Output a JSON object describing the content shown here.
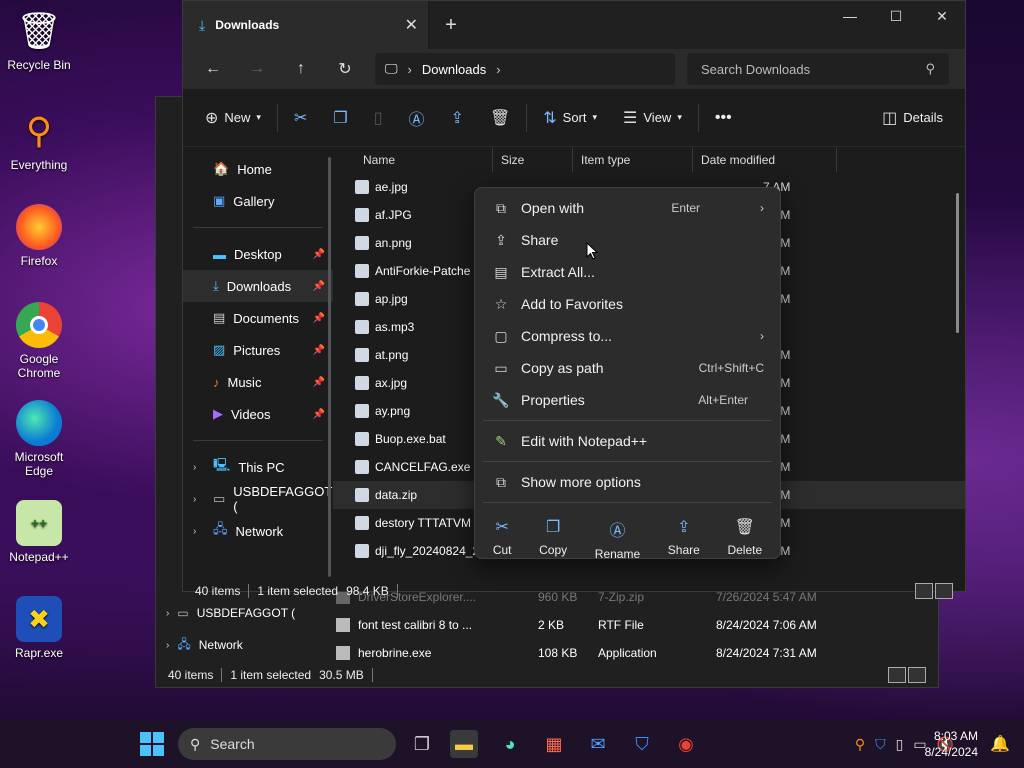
{
  "desktop": [
    {
      "label": "Recycle Bin",
      "icon": "recycle-bin-icon"
    },
    {
      "label": "Everything",
      "icon": "everything-icon"
    },
    {
      "label": "Firefox",
      "icon": "firefox-icon"
    },
    {
      "label": "Google Chrome",
      "icon": "chrome-icon"
    },
    {
      "label": "Microsoft Edge",
      "icon": "edge-icon"
    },
    {
      "label": "Notepad++",
      "icon": "notepad-plus-plus-icon"
    },
    {
      "label": "Rapr.exe",
      "icon": "rapr-icon"
    }
  ],
  "window": {
    "tab_title": "Downloads",
    "address": {
      "segment": "Downloads"
    },
    "search_placeholder": "Search Downloads",
    "toolbar": {
      "new": "New",
      "sort": "Sort",
      "view": "View",
      "details": "Details"
    }
  },
  "sidebar": {
    "home": "Home",
    "gallery": "Gallery",
    "desktop": "Desktop",
    "downloads": "Downloads",
    "documents": "Documents",
    "pictures": "Pictures",
    "music": "Music",
    "videos": "Videos",
    "this_pc": "This PC",
    "usb": "USBDEFAGGOT (",
    "network": "Network"
  },
  "columns": {
    "name": "Name",
    "size": "Size",
    "type": "Item type",
    "date": "Date modified"
  },
  "files": [
    {
      "name": "ae.jpg",
      "time": "7 AM"
    },
    {
      "name": "af.JPG",
      "time": "8 AM"
    },
    {
      "name": "an.png",
      "time": "0 AM"
    },
    {
      "name": "AntiForkie-Patche",
      "time": "8 AM"
    },
    {
      "name": "ap.jpg",
      "time": "0 AM"
    },
    {
      "name": "as.mp3",
      "time": "AM"
    },
    {
      "name": "at.png",
      "time": "8 AM"
    },
    {
      "name": "ax.jpg",
      "time": "8 AM"
    },
    {
      "name": "ay.png",
      "time": "8 AM"
    },
    {
      "name": "Buop.exe.bat",
      "time": "8 AM"
    },
    {
      "name": "CANCELFAG.exe",
      "time": "8 AM"
    },
    {
      "name": "data.zip",
      "time": "6 AM"
    },
    {
      "name": "destory TTTATVM",
      "time": "8 AM"
    },
    {
      "name": "dji_fly_20240824_2",
      "time": "0 AM"
    }
  ],
  "status": {
    "count": "40 items",
    "selected": "1 item selected",
    "size": "98.4 KB"
  },
  "context_menu": {
    "open_with": "Open with",
    "open_with_sc": "Enter",
    "share": "Share",
    "extract": "Extract All...",
    "favorites": "Add to Favorites",
    "compress": "Compress to...",
    "copy_path": "Copy as path",
    "copy_path_sc": "Ctrl+Shift+C",
    "properties": "Properties",
    "properties_sc": "Alt+Enter",
    "notepad": "Edit with Notepad++",
    "more": "Show more options",
    "quick": {
      "cut": "Cut",
      "copy": "Copy",
      "rename": "Rename",
      "share": "Share",
      "delete": "Delete"
    }
  },
  "back_window": {
    "sidebar": {
      "usb": "USBDEFAGGOT (",
      "network": "Network"
    },
    "files": [
      {
        "name": "DriverStoreExplorer....",
        "size": "960 KB",
        "type": "7-Zip.zip",
        "date": "7/26/2024 5:47 AM"
      },
      {
        "name": "font test calibri 8 to ...",
        "size": "2 KB",
        "type": "RTF File",
        "date": "8/24/2024 7:06 AM"
      },
      {
        "name": "herobrine.exe",
        "size": "108 KB",
        "type": "Application",
        "date": "8/24/2024 7:31 AM"
      }
    ],
    "status": {
      "count": "40 items",
      "selected": "1 item selected",
      "size": "30.5 MB"
    }
  },
  "taskbar": {
    "search": "Search",
    "time": "8:03 AM",
    "date": "8/24/2024"
  }
}
